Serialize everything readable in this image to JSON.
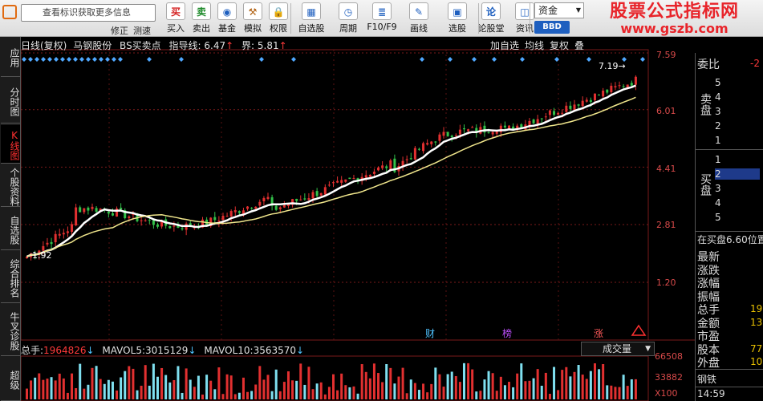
{
  "toolbar": {
    "search_placeholder": "查看标识获取更多信息",
    "sub_left": "修正",
    "sub_left2": "测速",
    "buttons": [
      {
        "label": "买入",
        "icon": "买",
        "color": "#d42020"
      },
      {
        "label": "卖出",
        "icon": "卖",
        "color": "#1d8a2a"
      },
      {
        "label": "基金",
        "icon": "◉",
        "color": "#1e5fbf"
      },
      {
        "label": "模拟",
        "icon": "⚒",
        "color": "#b06010"
      },
      {
        "label": "权限",
        "icon": "🔒",
        "color": "#c09020"
      },
      {
        "label": "自选股",
        "icon": "▦",
        "color": "#1e5fbf"
      },
      {
        "label": "周期",
        "icon": "◷",
        "color": "#1e5fbf"
      },
      {
        "label": "F10/F9",
        "icon": "≣",
        "color": "#1e5fbf"
      },
      {
        "label": "画线",
        "icon": "✎",
        "color": "#1e5fbf"
      },
      {
        "label": "选股",
        "icon": "▣",
        "color": "#1e5fbf"
      },
      {
        "label": "论股堂",
        "icon": "论",
        "color": "#1e5fbf"
      },
      {
        "label": "资讯",
        "icon": "◫",
        "color": "#1e5fbf"
      }
    ],
    "zixuan_label": "资金",
    "bbd_label": "BBD",
    "brand_line1": "股票公式指标网",
    "brand_line2": "www.gszb.com"
  },
  "vtabs": [
    "应用",
    "分时图",
    "K线图",
    "个股资料",
    "自选股",
    "综合排名",
    "牛叉诊股",
    "超级"
  ],
  "info": {
    "period": "日线(复权)",
    "stock": "马钢股份",
    "indicator": "BS买卖点",
    "guide_label": "指导线:",
    "guide_value": "6.47",
    "limit_label": "界:",
    "limit_value": "5.81",
    "right_tabs": [
      "加自选",
      "均线",
      "复权",
      "叠"
    ]
  },
  "chart_data": {
    "type": "candlestick",
    "ylim": [
      1.2,
      7.59
    ],
    "y_ticks": [
      "7.59",
      "6.01",
      "4.41",
      "2.81",
      "1.20"
    ],
    "annotations": {
      "low": "1.92",
      "high": "7.19→"
    },
    "markers": [
      "财",
      "榜",
      "涨"
    ],
    "guide_line": 6.47,
    "limit_line": 5.81
  },
  "volume": {
    "total_label": "总手:",
    "total_value": "1964826",
    "mavol5_label": "MAVOL5:",
    "mavol5_value": "3015129",
    "mavol10_label": "MAVOL10:",
    "mavol10_value": "3563570",
    "dropdown": "成交量",
    "y_ticks": [
      "66508",
      "33882",
      "X100"
    ]
  },
  "right_panel": {
    "weibi": "委比",
    "weibi_val": "-2",
    "sell_label": "卖盘",
    "buy_label": "买盘",
    "sell_levels": [
      "5",
      "4",
      "3",
      "2",
      "1"
    ],
    "buy_levels": [
      "1",
      "2",
      "3",
      "4",
      "5"
    ],
    "bid_note": "在买盘6.60位置",
    "fields": [
      {
        "label": "最新",
        "value": ""
      },
      {
        "label": "涨跌",
        "value": ""
      },
      {
        "label": "涨幅",
        "value": ""
      },
      {
        "label": "振幅",
        "value": ""
      },
      {
        "label": "总手",
        "value": "19"
      },
      {
        "label": "金额",
        "value": "13"
      },
      {
        "label": "市盈",
        "value": ""
      },
      {
        "label": "股本",
        "value": "77"
      },
      {
        "label": "外盘",
        "value": "10"
      }
    ],
    "sector": "钢铁",
    "time": "14:59"
  }
}
